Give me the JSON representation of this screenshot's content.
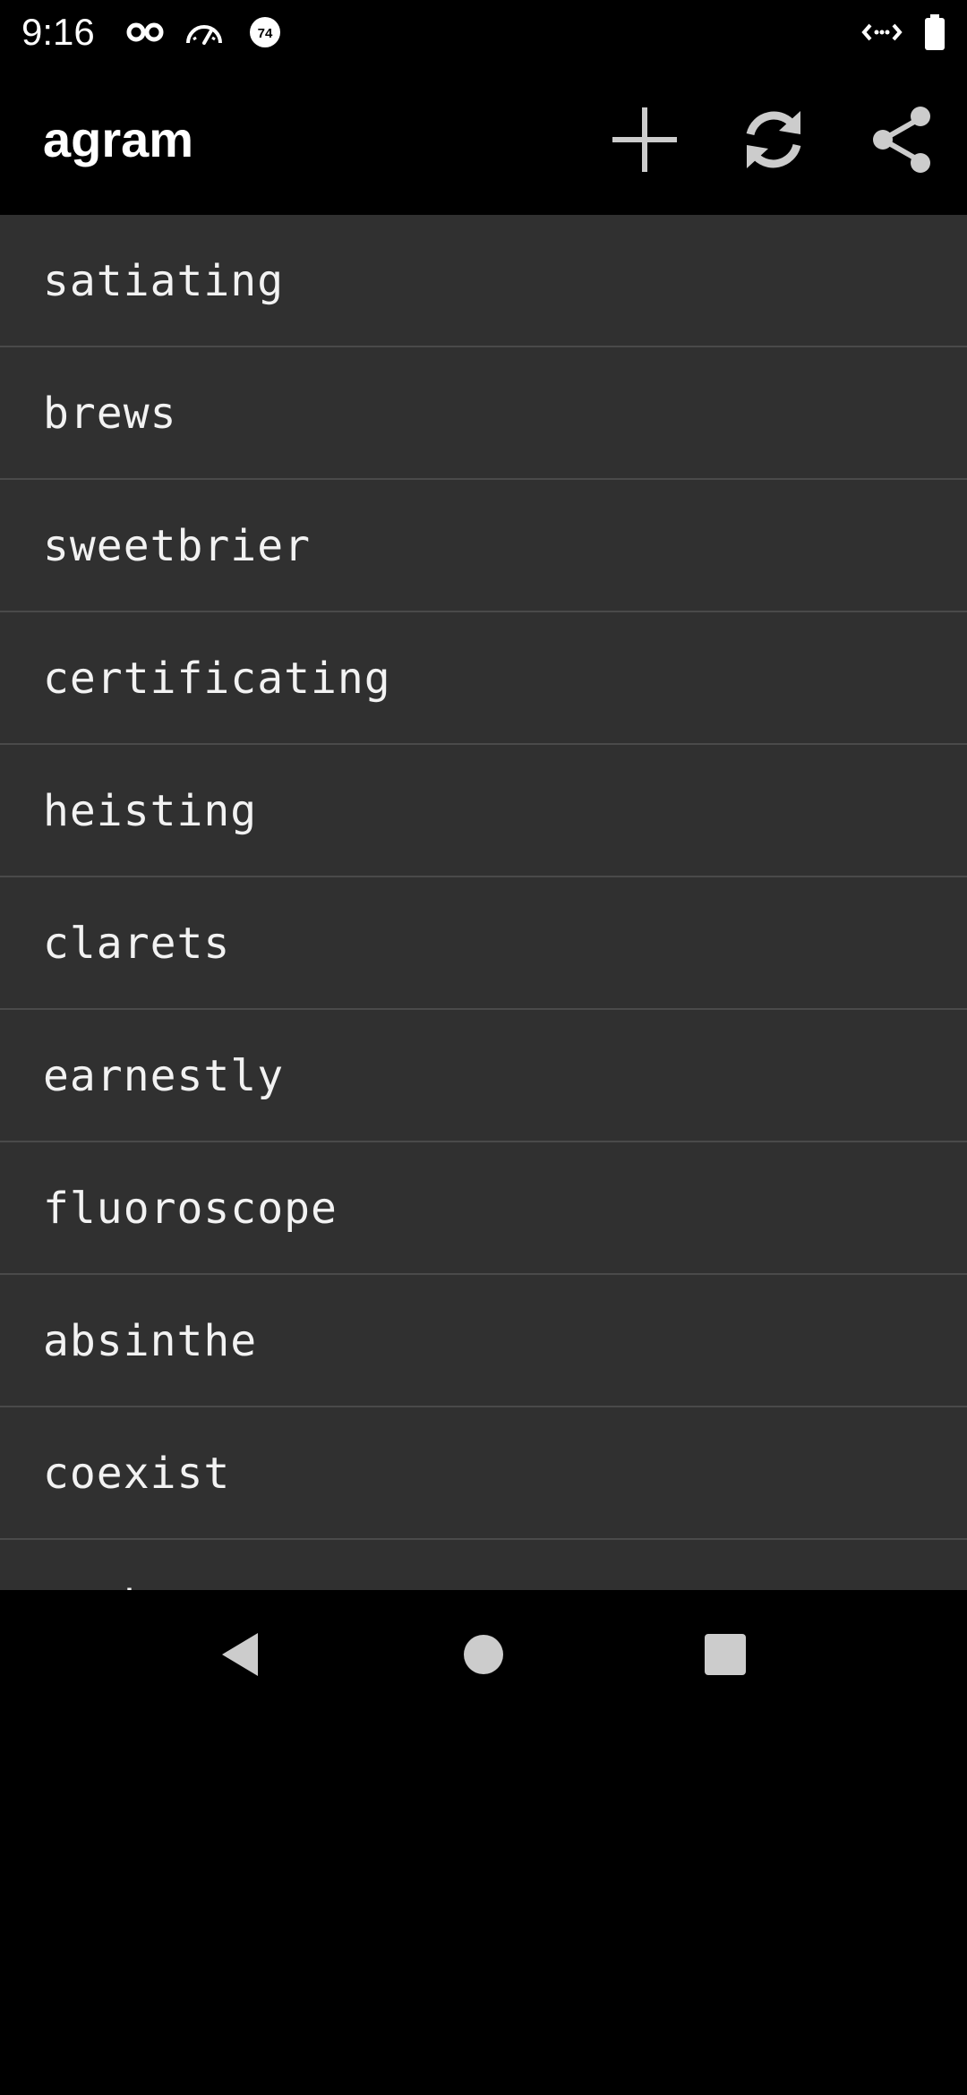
{
  "status_bar": {
    "time": "9:16",
    "icons": [
      "incognito-icon",
      "speedometer-icon",
      "notification-74-icon",
      "data-transfer-icon",
      "battery-icon"
    ],
    "badge_number": "74"
  },
  "app_bar": {
    "title": "agram",
    "actions": [
      {
        "name": "add",
        "icon": "plus-icon"
      },
      {
        "name": "refresh",
        "icon": "refresh-icon"
      },
      {
        "name": "share",
        "icon": "share-icon"
      }
    ]
  },
  "words": [
    "satiating",
    "brews",
    "sweetbrier",
    "certificating",
    "heisting",
    "clarets",
    "earnestly",
    "fluoroscope",
    "absinthe",
    "coexist",
    "washerwoman"
  ],
  "nav_bar": {
    "buttons": [
      "back-icon",
      "home-icon",
      "recents-icon"
    ]
  },
  "colors": {
    "background": "#000000",
    "list_background": "#303030",
    "divider": "#4a4a4a",
    "text": "#f2f2f2",
    "icon": "#cccccc"
  }
}
